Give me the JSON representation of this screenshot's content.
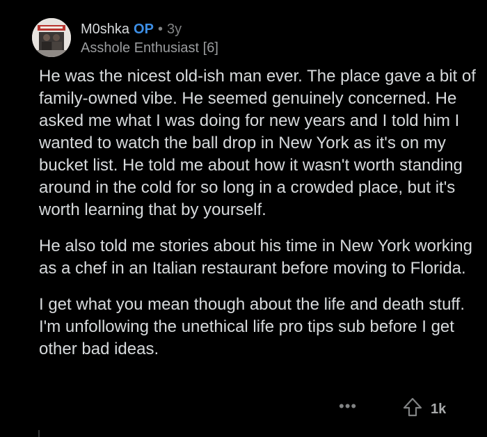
{
  "comment": {
    "author": "M0shka",
    "op_badge": "OP",
    "separator": "•",
    "age": "3y",
    "flair": "Asshole Enthusiast [6]",
    "paragraphs": [
      "He was the nicest old-ish man ever. The place gave a bit of family-owned vibe. He seemed genuinely concerned. He asked me what I was doing for new years and I told him I wanted to watch the ball drop in New York as it's on my bucket list. He told me about how it wasn't worth standing around in the cold for so long in a crowded place, but it's worth learning that by yourself.",
      "He also told me stories about his time in New York working as a chef in an Italian restaurant before moving to Florida.",
      "I get what you mean though about the life and death stuff. I'm unfollowing the unethical life pro tips sub before I get other bad ideas."
    ],
    "more_options": "•••",
    "upvote_icon": "upvote-arrow-icon",
    "score": "1k"
  },
  "colors": {
    "background": "#000000",
    "text": "#d7dadc",
    "muted": "#818384",
    "op_accent": "#3d8fe6"
  }
}
